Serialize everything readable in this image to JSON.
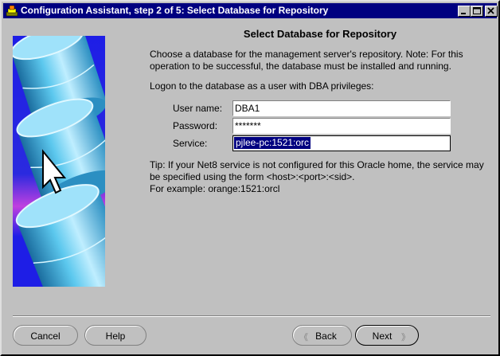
{
  "window": {
    "title": "Configuration Assistant, step 2 of 5: Select Database for Repository",
    "icon": "oracle-app-icon"
  },
  "colors": {
    "titlebar": "#000080",
    "face": "#c0c0c0",
    "art_background": "#1e1ee6",
    "cylinder": "#48b4d8",
    "selection": "#000080"
  },
  "page": {
    "heading": "Select Database for Repository",
    "intro": "Choose a database for the management server's repository. Note: For this operation to be successful, the database must be installed and running.",
    "logon_note": "Logon to the database as a user with DBA privileges:"
  },
  "form": {
    "username": {
      "label": "User name:",
      "value": "DBA1"
    },
    "password": {
      "label": "Password:",
      "value": "*******"
    },
    "service": {
      "label": "Service:",
      "value": "pjlee-pc:1521:orc"
    }
  },
  "tip": {
    "line1": "Tip: If your Net8 service is not configured for this Oracle home, the service may be specified using the form <host>:<port>:<sid>.",
    "line2": "For example: orange:1521:orcl"
  },
  "buttons": {
    "cancel": "Cancel",
    "help": "Help",
    "back": "Back",
    "next": "Next",
    "back_arrow": "《",
    "next_arrow": "》"
  }
}
